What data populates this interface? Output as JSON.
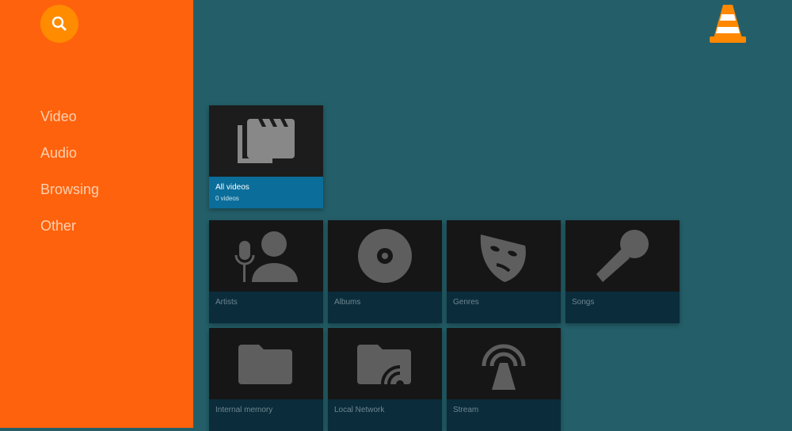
{
  "sidebar": {
    "search_icon": "search-icon",
    "items": [
      {
        "label": "Video"
      },
      {
        "label": "Audio"
      },
      {
        "label": "Browsing"
      },
      {
        "label": "Other"
      }
    ]
  },
  "video": {
    "cards": [
      {
        "title": "All videos",
        "subtitle": "0 videos",
        "icon": "video-clapperboard-icon"
      }
    ]
  },
  "audio": {
    "cards": [
      {
        "title": "Artists",
        "icon": "artist-icon"
      },
      {
        "title": "Albums",
        "icon": "album-icon"
      },
      {
        "title": "Genres",
        "icon": "genre-mask-icon"
      },
      {
        "title": "Songs",
        "icon": "microphone-icon"
      }
    ]
  },
  "browsing": {
    "cards": [
      {
        "title": "Internal memory",
        "icon": "folder-icon"
      },
      {
        "title": "Local Network",
        "icon": "network-folder-icon"
      },
      {
        "title": "Stream",
        "icon": "stream-icon"
      }
    ]
  },
  "colors": {
    "sidebar": "#ff620c",
    "background": "#245f69",
    "selected": "#0b6d9a"
  }
}
